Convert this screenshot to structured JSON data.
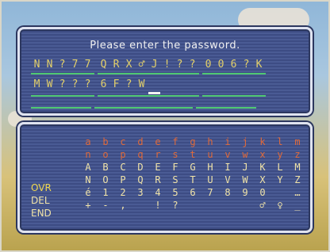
{
  "prompt": "Please enter the password.",
  "password": {
    "row1": [
      [
        "N",
        "N",
        "?",
        "7",
        "7"
      ],
      [
        "Q",
        "R",
        "X",
        "♂",
        "J",
        "!",
        "?",
        "?"
      ],
      [
        "0",
        "0",
        "6",
        "?",
        "K"
      ]
    ],
    "row2": [
      [
        "M",
        "W",
        "?",
        "?",
        "?"
      ],
      [
        "6",
        "F",
        "?",
        "W",
        ""
      ],
      []
    ]
  },
  "commands": [
    "OVR",
    "DEL",
    "END"
  ],
  "keyboard": {
    "rows": [
      [
        "a",
        "b",
        "c",
        "d",
        "e",
        "f",
        "g",
        "h",
        "i",
        "j",
        "k",
        "l",
        "m"
      ],
      [
        "n",
        "o",
        "p",
        "q",
        "r",
        "s",
        "t",
        "u",
        "v",
        "w",
        "x",
        "y",
        "z"
      ],
      [
        "A",
        "B",
        "C",
        "D",
        "E",
        "F",
        "G",
        "H",
        "I",
        "J",
        "K",
        "L",
        "M"
      ],
      [
        "N",
        "O",
        "P",
        "Q",
        "R",
        "S",
        "T",
        "U",
        "V",
        "W",
        "X",
        "Y",
        "Z"
      ],
      [
        "é",
        "1",
        "2",
        "3",
        "4",
        "5",
        "6",
        "7",
        "8",
        "9",
        "0",
        "",
        "…"
      ],
      [
        "+",
        "-",
        ",",
        "",
        "!",
        "?",
        "",
        "",
        "",
        "",
        "♂",
        "♀",
        "_"
      ]
    ],
    "row_colors": [
      "#e06a3a",
      "#e06a3a",
      "#f0e3a8",
      "#f0e3a8",
      "#f0e3a8",
      "#f0e3a8"
    ]
  },
  "colors": {
    "panel": "#4a5b94",
    "accent_underline": "#50c872",
    "entered_text": "#e3d06a"
  }
}
